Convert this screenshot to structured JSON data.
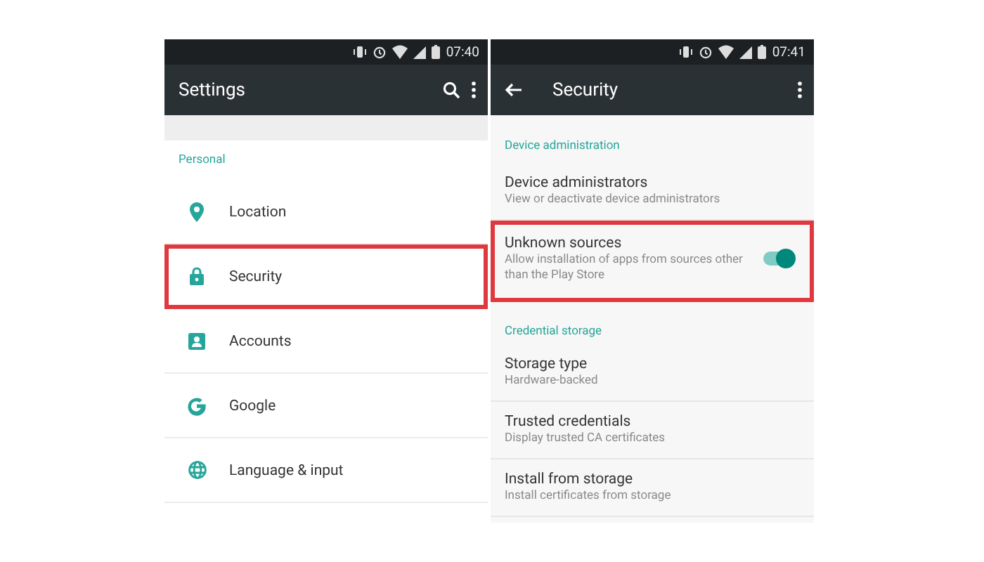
{
  "screens": [
    {
      "kind": "list",
      "status_bar": {
        "time": "07:40"
      },
      "app_bar": {
        "title": "Settings",
        "actions": [
          {
            "kind": "search"
          },
          {
            "kind": "menu"
          }
        ]
      },
      "sections": [
        {
          "header": "Personal",
          "items": [
            {
              "label": "Location",
              "highlighted": false
            },
            {
              "label": "Security",
              "highlighted": true
            },
            {
              "label": "Accounts",
              "highlighted": false
            },
            {
              "label": "Google",
              "highlighted": false
            },
            {
              "label": "Language & input",
              "highlighted": false
            }
          ]
        }
      ]
    },
    {
      "kind": "detail",
      "status_bar": {
        "time": "07:41"
      },
      "app_bar": {
        "title": "Security",
        "leading": [
          {
            "kind": "back"
          }
        ],
        "actions": [
          {
            "kind": "menu"
          }
        ]
      },
      "sections": [
        {
          "header": "Device administration",
          "items": [
            {
              "label": "Device administrators",
              "summary": "View or deactivate device administrators",
              "highlighted": false
            },
            {
              "label": "Unknown sources",
              "summary": "Allow installation of apps from sources other than the Play Store",
              "highlighted": true,
              "toggle": {
                "on": true
              }
            }
          ]
        },
        {
          "header": "Credential storage",
          "items": [
            {
              "label": "Storage type",
              "summary": "Hardware-backed",
              "highlighted": false
            },
            {
              "label": "Trusted credentials",
              "summary": "Display trusted CA certificates",
              "highlighted": false
            },
            {
              "label": "Install from storage",
              "summary": "Install certificates from storage",
              "highlighted": false
            }
          ]
        }
      ]
    }
  ]
}
